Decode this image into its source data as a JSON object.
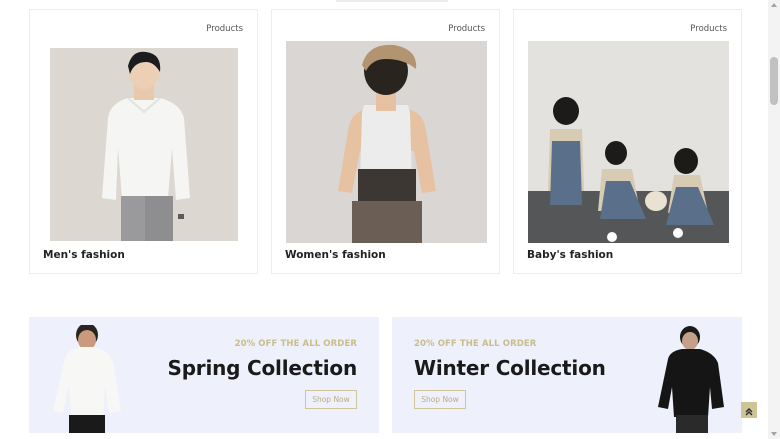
{
  "cards": [
    {
      "tag": "Products",
      "title": "Men's fashion"
    },
    {
      "tag": "Products",
      "title": "Women's fashion"
    },
    {
      "tag": "Products",
      "title": "Baby's fashion"
    }
  ],
  "promos": [
    {
      "subtitle": "20% OFF THE ALL ORDER",
      "title": "Spring Collection",
      "button": "Shop Now"
    },
    {
      "subtitle": "20% OFF THE ALL ORDER",
      "title": "Winter Collection",
      "button": "Shop Now"
    }
  ],
  "colors": {
    "accent": "#cdc596",
    "promo_background": "#eef0fb"
  },
  "icons": {
    "scroll_to_top": "double-chevron-up-icon"
  }
}
